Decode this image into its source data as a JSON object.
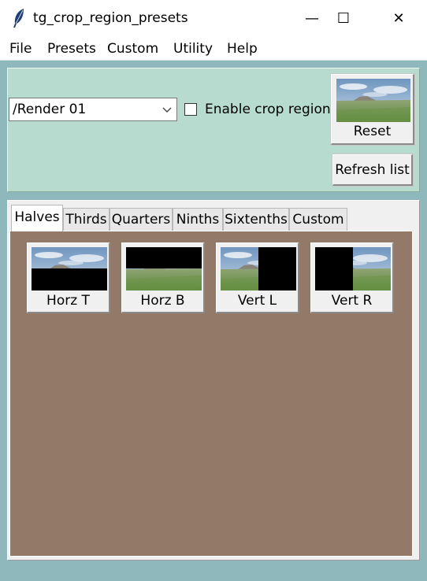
{
  "window": {
    "title": "tg_crop_region_presets",
    "controls": {
      "minimize": "—",
      "maximize": "☐",
      "close": "✕"
    }
  },
  "menu": [
    "File",
    "Presets",
    "Custom",
    "Utility",
    "Help"
  ],
  "toolbar": {
    "render_select": {
      "value": "/Render 01"
    },
    "enable_crop": {
      "label": "Enable crop region",
      "checked": false
    },
    "reset_label": "Reset",
    "refresh_label": "Refresh list"
  },
  "tabs": [
    {
      "label": "Halves",
      "active": true
    },
    {
      "label": "Thirds",
      "active": false
    },
    {
      "label": "Quarters",
      "active": false
    },
    {
      "label": "Ninths",
      "active": false
    },
    {
      "label": "Sixtenths",
      "active": false
    },
    {
      "label": "Custom",
      "active": false
    }
  ],
  "presets": [
    {
      "label": "Horz T",
      "crop": "top"
    },
    {
      "label": "Horz B",
      "crop": "bottom"
    },
    {
      "label": "Vert L",
      "crop": "left"
    },
    {
      "label": "Vert R",
      "crop": "right"
    }
  ],
  "colors": {
    "window_bg": "#8fb8bd",
    "top_panel": "#b7dccf",
    "tab_content": "#937a68"
  }
}
